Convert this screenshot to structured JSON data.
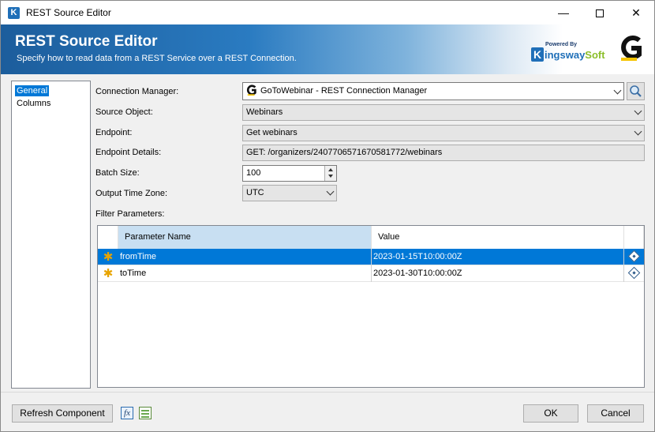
{
  "window": {
    "title": "REST Source Editor",
    "app_icon_letter": "K"
  },
  "banner": {
    "title": "REST Source Editor",
    "subtitle": "Specify how to read data from a REST Service over a REST Connection.",
    "kws_powered": "Powered By",
    "kws_k": "K",
    "kws_name_main": "ingsway",
    "kws_name_accent": "Soft"
  },
  "nav": {
    "items": [
      {
        "label": "General",
        "selected": true
      },
      {
        "label": "Columns",
        "selected": false
      }
    ]
  },
  "form": {
    "connection_manager": {
      "label": "Connection Manager:",
      "value": "GoToWebinar - REST Connection Manager"
    },
    "source_object": {
      "label": "Source Object:",
      "value": "Webinars"
    },
    "endpoint": {
      "label": "Endpoint:",
      "value": "Get webinars"
    },
    "endpoint_details": {
      "label": "Endpoint Details:",
      "value": "GET: /organizers/2407706571670581772/webinars"
    },
    "batch_size": {
      "label": "Batch Size:",
      "value": "100"
    },
    "output_time_zone": {
      "label": "Output Time Zone:",
      "value": "UTC"
    },
    "filter_parameters": {
      "label": "Filter Parameters:"
    }
  },
  "grid": {
    "columns": [
      "Parameter Name",
      "Value"
    ],
    "rows": [
      {
        "name": "fromTime",
        "value": "2023-01-15T10:00:00Z",
        "selected": true
      },
      {
        "name": "toTime",
        "value": "2023-01-30T10:00:00Z",
        "selected": false
      }
    ]
  },
  "footer": {
    "refresh_label": "Refresh Component",
    "fx_label": "fx",
    "ok_label": "OK",
    "cancel_label": "Cancel"
  },
  "icons": {
    "app": "kingswaysoft-k-icon",
    "search": "search-icon",
    "fx": "expression-icon",
    "sheet": "spreadsheet-icon",
    "param": "diamond-icon",
    "new_row": "asterisk-icon"
  },
  "colors": {
    "accent": "#0078d7",
    "banner": "#1c5d9c",
    "star": "#e8a400"
  }
}
